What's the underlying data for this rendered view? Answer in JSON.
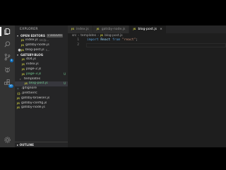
{
  "explorer": {
    "title": "EXPLORER",
    "open_editors_label": "OPEN EDITORS",
    "unsaved_badge": "1 UNSAVED",
    "open_editors": [
      {
        "name": "index.js",
        "path": "src/p..."
      },
      {
        "name": "gatsby-node.js",
        "path": ""
      },
      {
        "name": "blog-post.js",
        "path": "s..."
      }
    ],
    "project_label": "GATSBY-BLOG",
    "tree": [
      {
        "name": "404.js",
        "kind": "js",
        "marker": ""
      },
      {
        "name": "index.js",
        "kind": "js",
        "marker": ""
      },
      {
        "name": "page-2.js",
        "kind": "js",
        "marker": ""
      },
      {
        "name": "page-3.js",
        "kind": "js",
        "marker": "U"
      },
      {
        "name": "templates",
        "kind": "folder",
        "marker": ""
      },
      {
        "name": "blog-post.js",
        "kind": "js",
        "marker": "U"
      },
      {
        "name": ".gitignore",
        "kind": "file",
        "marker": ""
      },
      {
        "name": ".prettierrc",
        "kind": "json",
        "marker": ""
      },
      {
        "name": "gatsby-browser.js",
        "kind": "js",
        "marker": ""
      },
      {
        "name": "gatsby-config.js",
        "kind": "js",
        "marker": ""
      },
      {
        "name": "gatsby-node.js",
        "kind": "js",
        "marker": ""
      }
    ],
    "outline_label": "OUTLINE"
  },
  "activity": {
    "scm_badge": "1",
    "ext_badge": "10"
  },
  "tabs": [
    {
      "label": "index.js",
      "active": false
    },
    {
      "label": "gatsby-node.js",
      "active": false
    },
    {
      "label": "blog-post.js",
      "active": true
    }
  ],
  "breadcrumb": [
    "src",
    "templates",
    "blog-post.js"
  ],
  "code": {
    "lines": [
      "1",
      "2"
    ],
    "line1": {
      "kw": "import",
      "id": "React",
      "from": "from",
      "str": "\"react\"",
      "end": ";"
    }
  },
  "colors": {
    "accent": "#0e70c0",
    "js_icon": "#cbcb41",
    "untracked": "#73c991",
    "folder": "#c09553"
  }
}
